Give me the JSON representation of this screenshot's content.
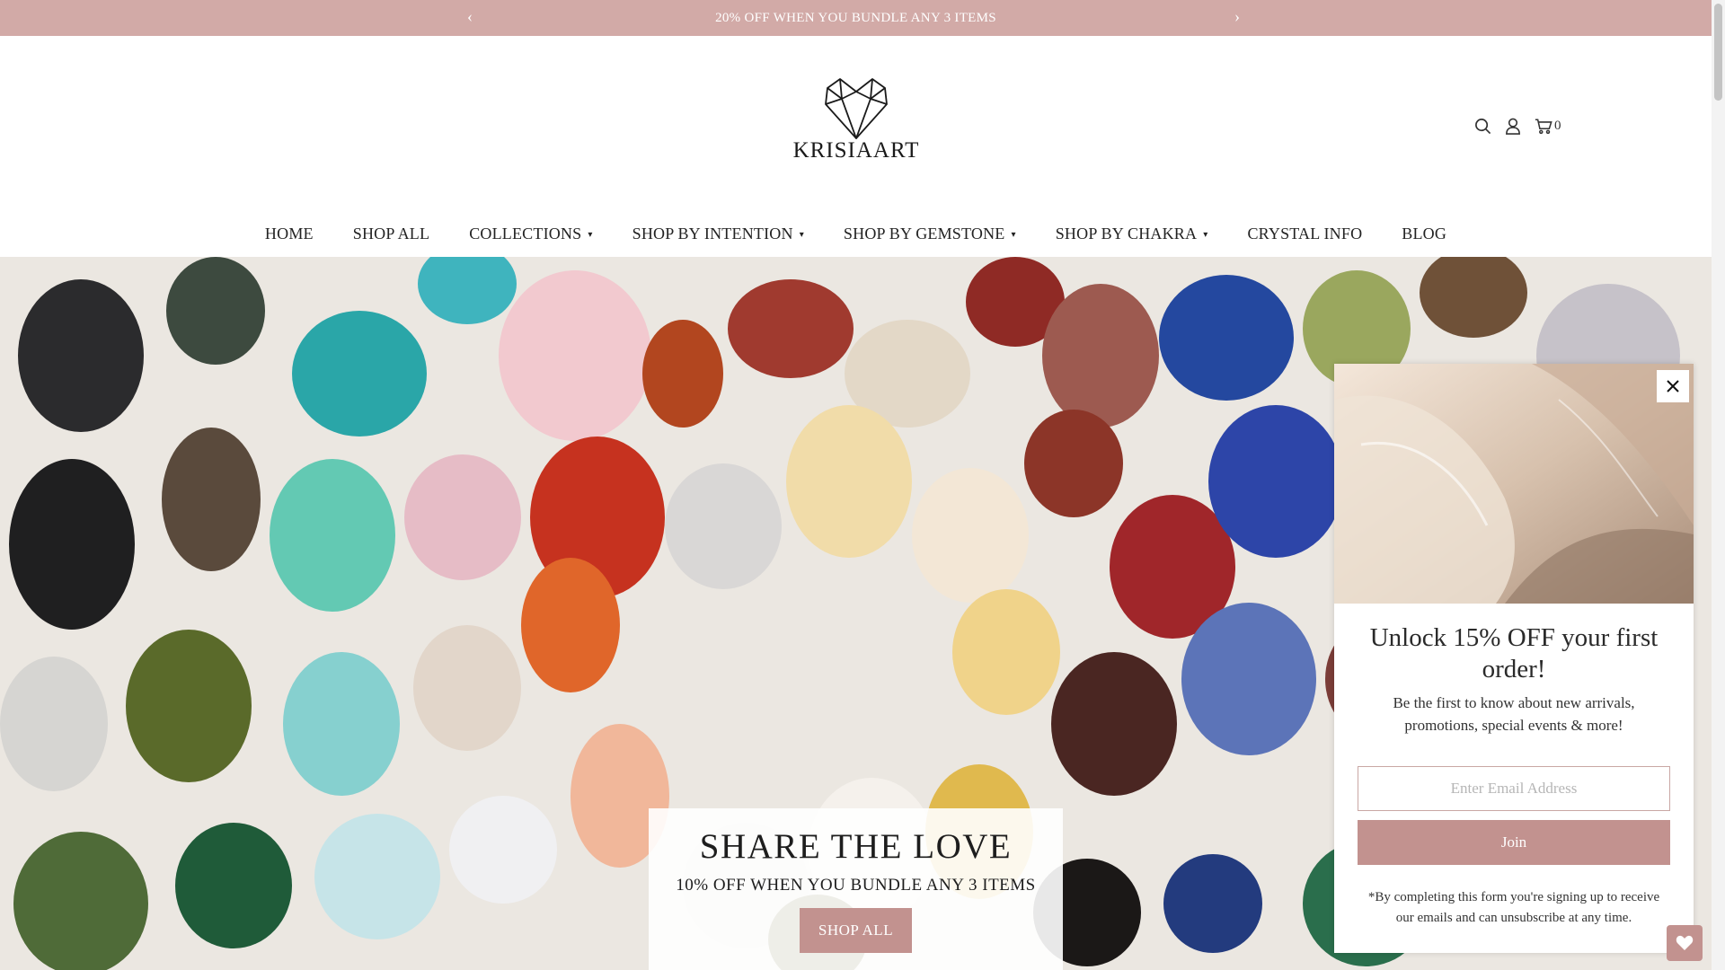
{
  "announcement": {
    "text": "20% OFF WHEN YOU BUNDLE ANY 3 ITEMS",
    "prev_icon": "chevron-left-icon",
    "next_icon": "chevron-right-icon",
    "prev_glyph": "‹",
    "next_glyph": "›"
  },
  "brand": {
    "name": "KRISIAART",
    "logo_icon": "crystal-heart-logo"
  },
  "header_icons": {
    "search_icon": "search-icon",
    "account_icon": "user-icon",
    "cart_icon": "cart-icon",
    "cart_count": "0"
  },
  "nav": {
    "items": [
      {
        "label": "HOME",
        "dropdown": false
      },
      {
        "label": "SHOP ALL",
        "dropdown": false
      },
      {
        "label": "COLLECTIONS",
        "dropdown": true
      },
      {
        "label": "SHOP BY INTENTION",
        "dropdown": true
      },
      {
        "label": "SHOP BY GEMSTONE",
        "dropdown": true
      },
      {
        "label": "SHOP BY CHAKRA",
        "dropdown": true
      },
      {
        "label": "CRYSTAL INFO",
        "dropdown": false
      },
      {
        "label": "BLOG",
        "dropdown": false
      }
    ],
    "chevron": "▾"
  },
  "hero": {
    "title": "SHARE THE LOVE",
    "subtitle": "10% OFF WHEN YOU BUNDLE ANY 3 ITEMS",
    "button_label": "SHOP ALL"
  },
  "popup": {
    "heading": "Unlock 15% OFF your first order!",
    "description": "Be the first to know about new arrivals, promotions, special events & more!",
    "email_placeholder": "Enter Email Address",
    "join_label": "Join",
    "fine_print": "*By completing this form you're signing up to receive our emails and can unsubscribe at any time.",
    "close_icon": "close-icon"
  },
  "wishlist": {
    "icon": "heart-icon"
  },
  "colors": {
    "announcement_bg": "#d2aaa7",
    "accent": "#c2928f",
    "text": "#222222"
  }
}
